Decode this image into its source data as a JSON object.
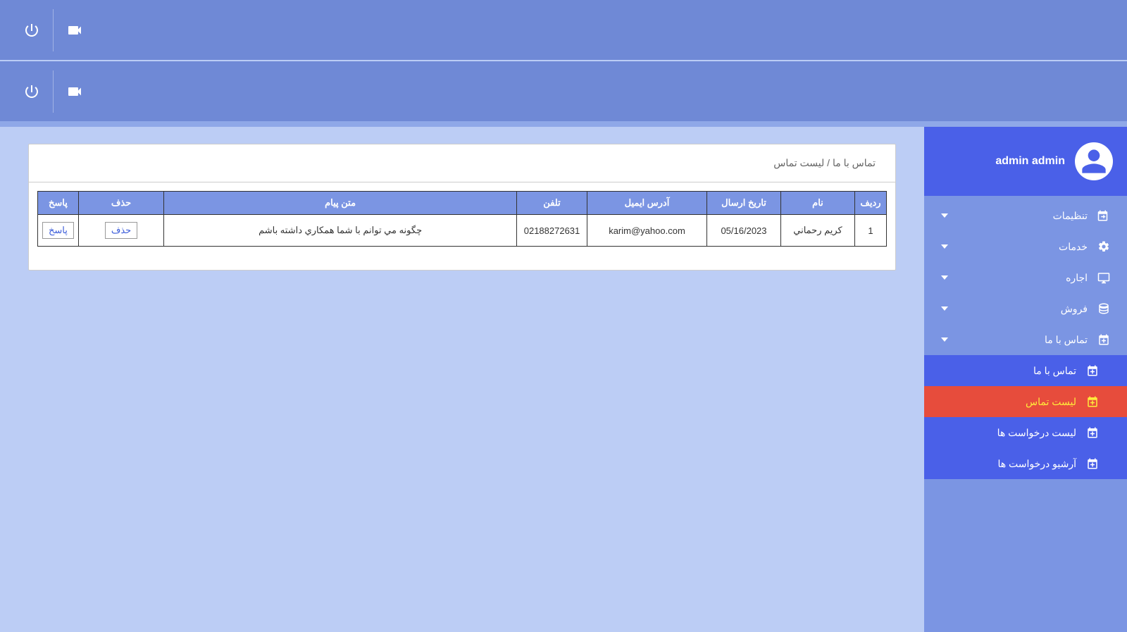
{
  "user": {
    "name": "admin admin"
  },
  "nav": {
    "settings": "تنظیمات",
    "services": "خدمات",
    "rent": "اجاره",
    "sale": "فروش",
    "contact": "تماس با ما",
    "sub": {
      "contact_us": "تماس با ما",
      "contact_list": "لیست تماس",
      "request_list": "لیست درخواست ها",
      "request_archive": "آرشیو درخواست ها"
    }
  },
  "breadcrumb": {
    "parent": "تماس با ما",
    "sep": " / ",
    "current": "لیست تماس"
  },
  "table": {
    "headers": {
      "row": "ردیف",
      "name": "نام",
      "date": "تاریخ ارسال",
      "email": "آدرس ایمیل",
      "phone": "تلفن",
      "message": "متن پیام",
      "delete": "حذف",
      "reply": "پاسخ"
    },
    "rows": [
      {
        "num": "1",
        "name": "كريم رحماني",
        "date": "05/16/2023",
        "email": "karim@yahoo.com",
        "phone": "02188272631",
        "message": "چگونه مي توانم با شما همكاري داشته باشم",
        "delete_label": "حذف",
        "reply_label": "پاسخ"
      }
    ]
  }
}
